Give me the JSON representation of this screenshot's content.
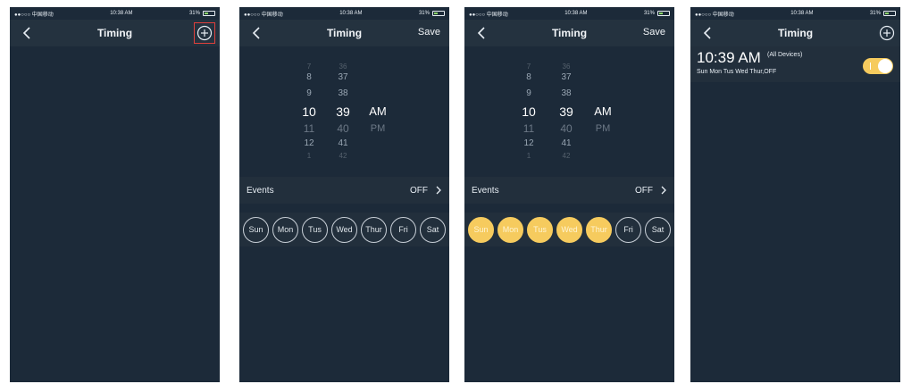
{
  "status": {
    "carrier": "●●○○○ 中国移动",
    "time": "10:38 AM",
    "battery": "31%"
  },
  "screens": [
    {
      "title": "Timing",
      "action_icon": "plus-circle-icon"
    },
    {
      "title": "Timing",
      "action": "Save"
    },
    {
      "title": "Timing",
      "action": "Save"
    },
    {
      "title": "Timing",
      "action_icon": "plus-circle-icon"
    }
  ],
  "picker": {
    "hours": [
      "7",
      "8",
      "9",
      "10",
      "11",
      "12",
      "1"
    ],
    "minutes": [
      "36",
      "37",
      "38",
      "39",
      "40",
      "41",
      "42"
    ],
    "ampm": [
      "AM",
      "PM"
    ]
  },
  "events": {
    "label": "Events",
    "value": "OFF"
  },
  "days": [
    "Sun",
    "Mon",
    "Tus",
    "Wed",
    "Thur",
    "Fri",
    "Sat"
  ],
  "days_selected_screen3": [
    true,
    true,
    true,
    true,
    true,
    false,
    false
  ],
  "timer": {
    "time": "10:39 AM",
    "scope": "(All Devices)",
    "days": "Sun Mon Tus Wed Thur,OFF",
    "enabled": true
  },
  "colors": {
    "background": "#1c2a39",
    "bar": "#24323f",
    "accent": "#f6cb5e",
    "highlight": "#e0403c"
  }
}
